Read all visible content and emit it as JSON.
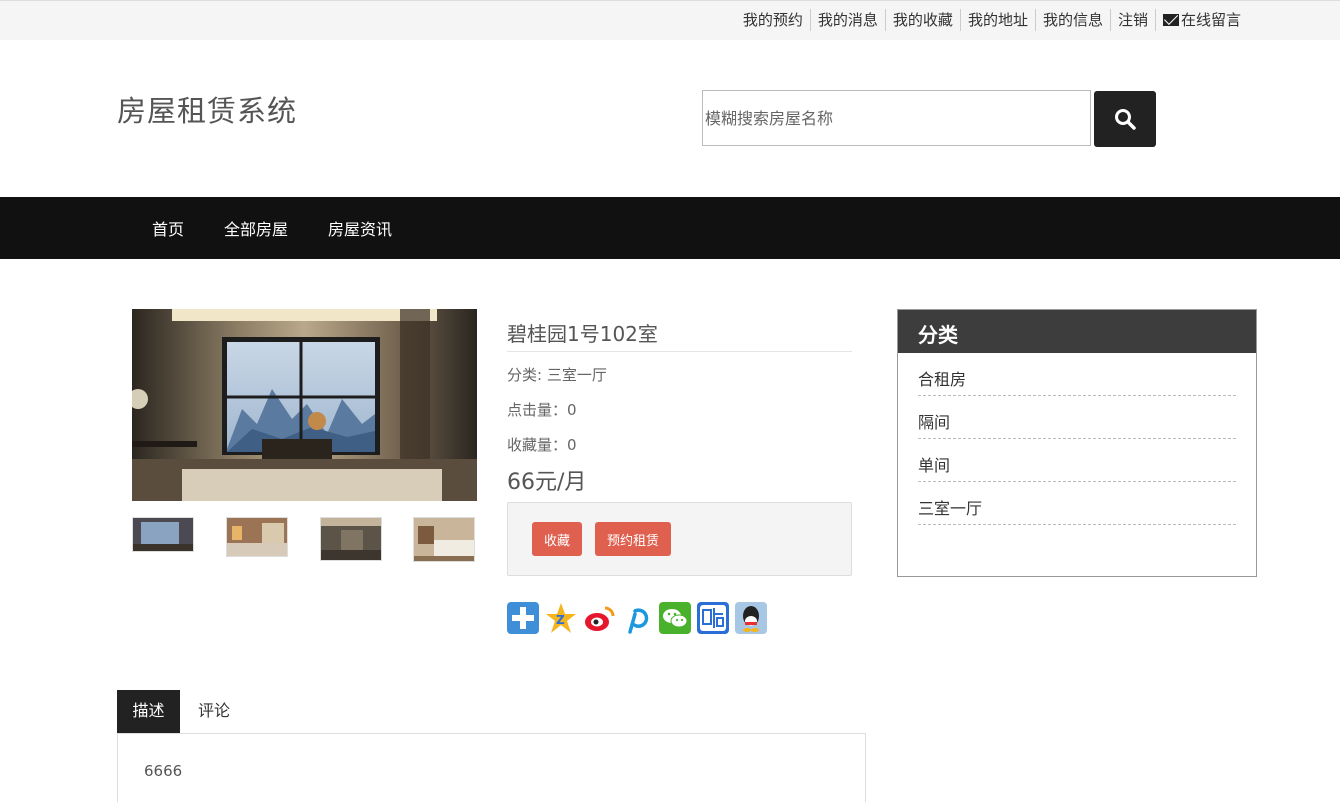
{
  "topbar": {
    "links": [
      "我的预约",
      "我的消息",
      "我的收藏",
      "我的地址",
      "我的信息",
      "注销",
      "在线留言"
    ]
  },
  "header": {
    "logo": "房屋租赁系统",
    "search_placeholder": "模糊搜索房屋名称"
  },
  "nav": {
    "items": [
      "首页",
      "全部房屋",
      "房屋资讯"
    ]
  },
  "product": {
    "title": "碧桂园1号102室",
    "category": "分类: 三室一厅",
    "clicks": "点击量：0",
    "favorites": "收藏量：0",
    "price": "66元/月",
    "favorite_button": "收藏",
    "reserve_button": "预约租赁"
  },
  "share_icons": [
    "plus-share-icon",
    "qzone-icon",
    "weibo-icon",
    "pinterest-icon",
    "wechat-icon",
    "tieba-icon",
    "qq-icon"
  ],
  "sidebar": {
    "title": "分类",
    "items": [
      "合租房",
      "隔间",
      "单间",
      "三室一厅"
    ]
  },
  "tabs": {
    "items": [
      "描述",
      "评论"
    ],
    "description": "6666"
  },
  "colors": {
    "nav_bg": "#111111",
    "accent_button": "#e06050",
    "sidebar_head": "#3d3d3d"
  }
}
